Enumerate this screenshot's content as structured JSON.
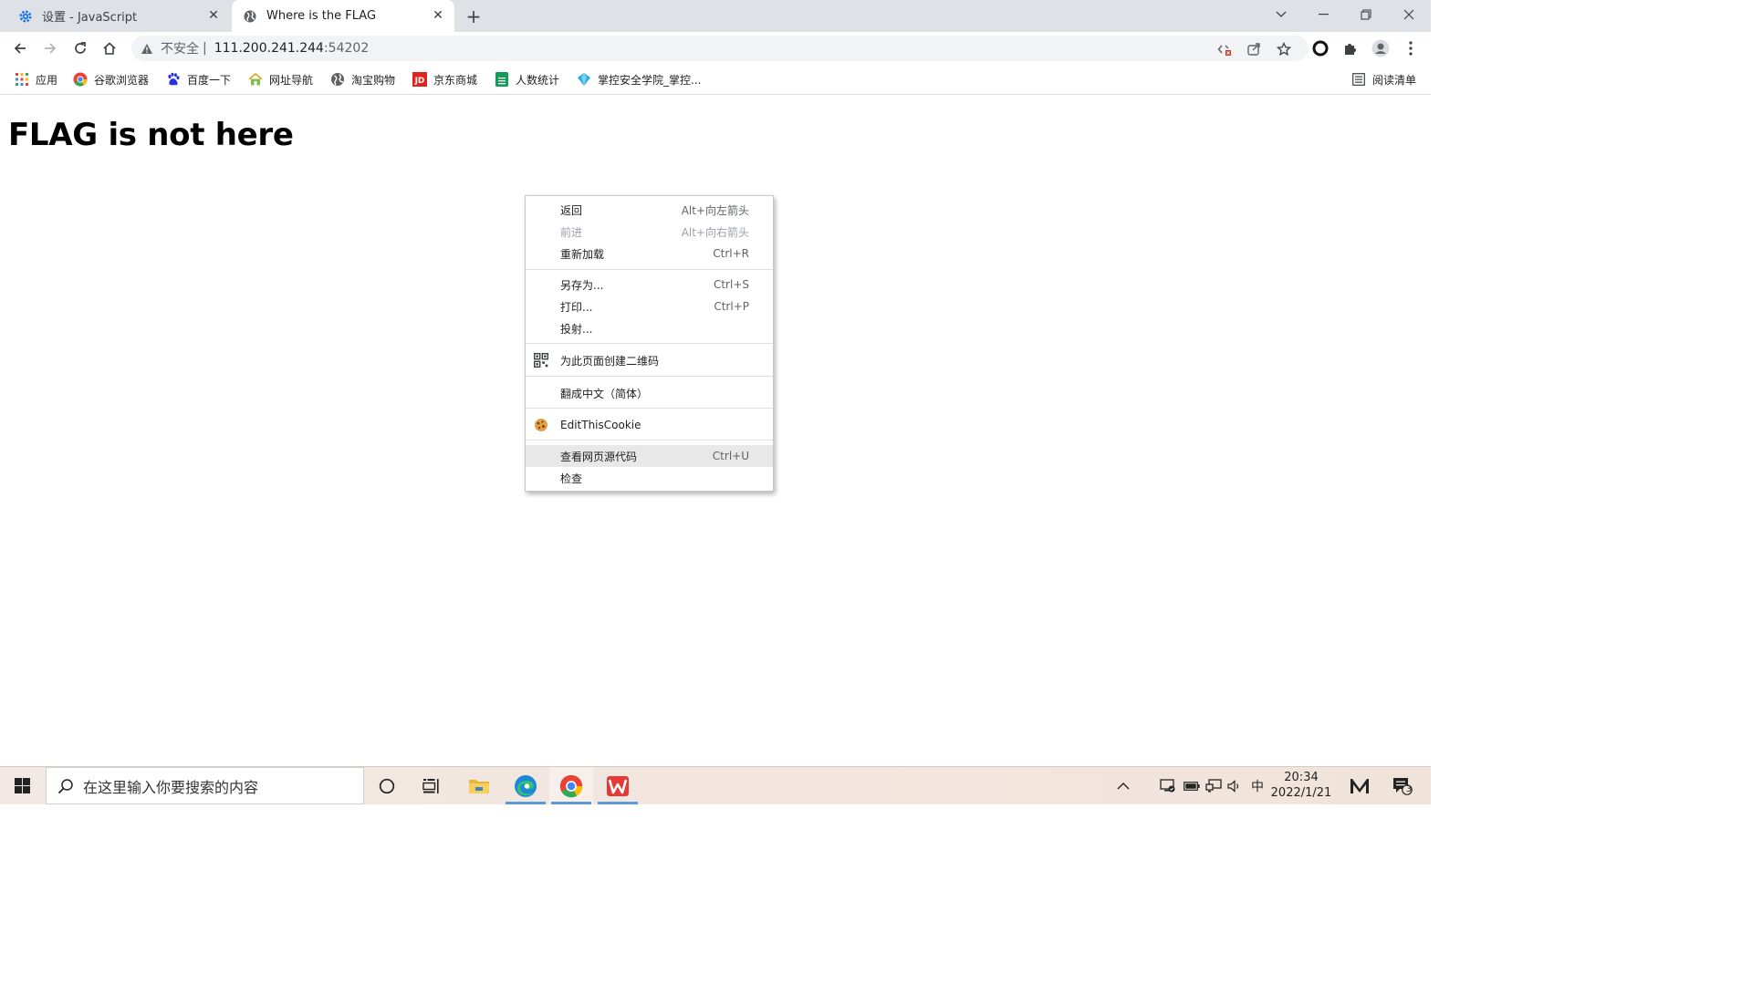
{
  "tabs": [
    {
      "title": "设置 - JavaScript",
      "icon": "gear-icon",
      "active": false
    },
    {
      "title": "Where is the FLAG",
      "icon": "globe-icon",
      "active": true
    }
  ],
  "window_controls": {
    "tab_search": "chevron-down-icon",
    "minimize": "minimize-icon",
    "restore": "restore-icon",
    "close": "close-icon"
  },
  "address_bar": {
    "security_label": "不安全",
    "separator": "|",
    "host": "111.200.241.244",
    "port": ":54202"
  },
  "bookmarks": [
    {
      "label": "应用",
      "icon": "apps-grid-icon"
    },
    {
      "label": "谷歌浏览器",
      "icon": "chrome-icon"
    },
    {
      "label": "百度一下",
      "icon": "baidu-paw-icon"
    },
    {
      "label": "网址导航",
      "icon": "house-icon"
    },
    {
      "label": "淘宝购物",
      "icon": "globe-icon"
    },
    {
      "label": "京东商城",
      "icon": "jd-icon"
    },
    {
      "label": "人数统计",
      "icon": "sheet-icon"
    },
    {
      "label": "掌控安全学院_掌控...",
      "icon": "shield-diamond-icon"
    }
  ],
  "reading_list": {
    "label": "阅读清单",
    "icon": "reading-list-icon"
  },
  "page": {
    "heading": "FLAG is not here"
  },
  "context_menu": {
    "items": [
      {
        "label": "返回",
        "shortcut": "Alt+向左箭头",
        "enabled": true
      },
      {
        "label": "前进",
        "shortcut": "Alt+向右箭头",
        "enabled": false
      },
      {
        "label": "重新加载",
        "shortcut": "Ctrl+R",
        "enabled": true
      },
      {
        "label": "另存为...",
        "shortcut": "Ctrl+S",
        "enabled": true
      },
      {
        "label": "打印...",
        "shortcut": "Ctrl+P",
        "enabled": true
      },
      {
        "label": "投射...",
        "shortcut": "",
        "enabled": true
      },
      {
        "label": "为此页面创建二维码",
        "shortcut": "",
        "enabled": true,
        "icon": "qr-code-icon"
      },
      {
        "label": "翻成中文（简体）",
        "shortcut": "",
        "enabled": true
      },
      {
        "label": "EditThisCookie",
        "shortcut": "",
        "enabled": true,
        "icon": "cookie-icon"
      },
      {
        "label": "查看网页源代码",
        "shortcut": "Ctrl+U",
        "enabled": true,
        "highlighted": true
      },
      {
        "label": "检查",
        "shortcut": "",
        "enabled": true
      }
    ]
  },
  "taskbar": {
    "search_placeholder": "在这里输入你要搜索的内容",
    "ime": "中",
    "time": "20:34",
    "date": "2022/1/21",
    "notification_count": "3"
  },
  "colors": {
    "tabstrip_bg": "#dee1e6",
    "omnibox_bg": "#f1f3f4",
    "menu_highlight": "#e8e8e8",
    "taskbar_accent": "#5b9bd5"
  }
}
